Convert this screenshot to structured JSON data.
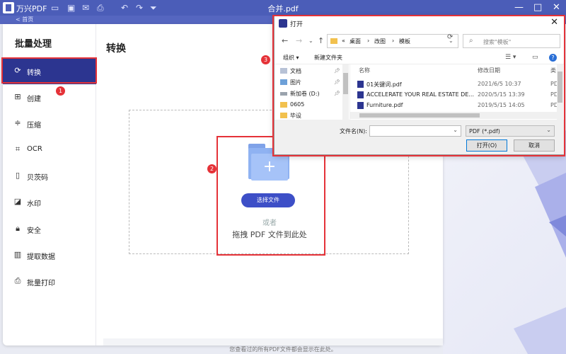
{
  "app": {
    "name": "万兴PDF",
    "window_title": "合并.pdf",
    "subtitle_fragment": "< 首页"
  },
  "sidebar": {
    "title": "批量处理",
    "items": [
      {
        "label": "转换",
        "icon": "refresh-icon",
        "active": true
      },
      {
        "label": "创建",
        "icon": "add-file-icon"
      },
      {
        "label": "压缩",
        "icon": "compress-icon"
      },
      {
        "label": "OCR",
        "icon": "ocr-scan-icon"
      },
      {
        "label": "贝茨码",
        "icon": "bates-icon"
      },
      {
        "label": "水印",
        "icon": "watermark-icon"
      },
      {
        "label": "安全",
        "icon": "lock-icon"
      },
      {
        "label": "提取数据",
        "icon": "bar-chart-icon"
      },
      {
        "label": "批量打印",
        "icon": "print-icon"
      }
    ]
  },
  "main": {
    "title": "转换",
    "select_button": "选择文件",
    "or_text": "或者",
    "drag_text": "拖拽 PDF 文件到此处"
  },
  "footer": {
    "text": "您查看过的所有PDF文件都会显示在此处。"
  },
  "annotations": [
    "1",
    "2",
    "3"
  ],
  "colors": {
    "accent": "#3d4fc7",
    "sidebar_active": "#2c3590",
    "highlight": "#e53238",
    "titlebar": "#4b5db8"
  },
  "dialog": {
    "title": "打开",
    "breadcrumb": [
      "«",
      "桌面",
      "›",
      "改图",
      "›",
      "模板"
    ],
    "search_placeholder": "搜索\"模板\"",
    "organize": "组织 ▾",
    "new_folder": "新建文件夹",
    "nav_items": [
      {
        "label": "文档",
        "pinned": true
      },
      {
        "label": "图片",
        "pinned": true
      },
      {
        "label": "新加卷 (D:)",
        "pinned": true
      },
      {
        "label": "0605",
        "pinned": false
      },
      {
        "label": "毕设",
        "pinned": false
      }
    ],
    "columns": {
      "name": "名称",
      "date": "修改日期",
      "type": "类"
    },
    "files": [
      {
        "name": "01关键词.pdf",
        "date": "2021/6/5 10:37",
        "type": "PD"
      },
      {
        "name": "ACCELERATE YOUR REAL ESTATE DE...",
        "date": "2020/5/15 13:39",
        "type": "PD"
      },
      {
        "name": "Furniture.pdf",
        "date": "2019/5/15 14:05",
        "type": "PD"
      }
    ],
    "filename_label": "文件名(N):",
    "filename_value": "",
    "filetype": "PDF (*.pdf)",
    "open_button": "打开(O)",
    "cancel_button": "取消"
  }
}
